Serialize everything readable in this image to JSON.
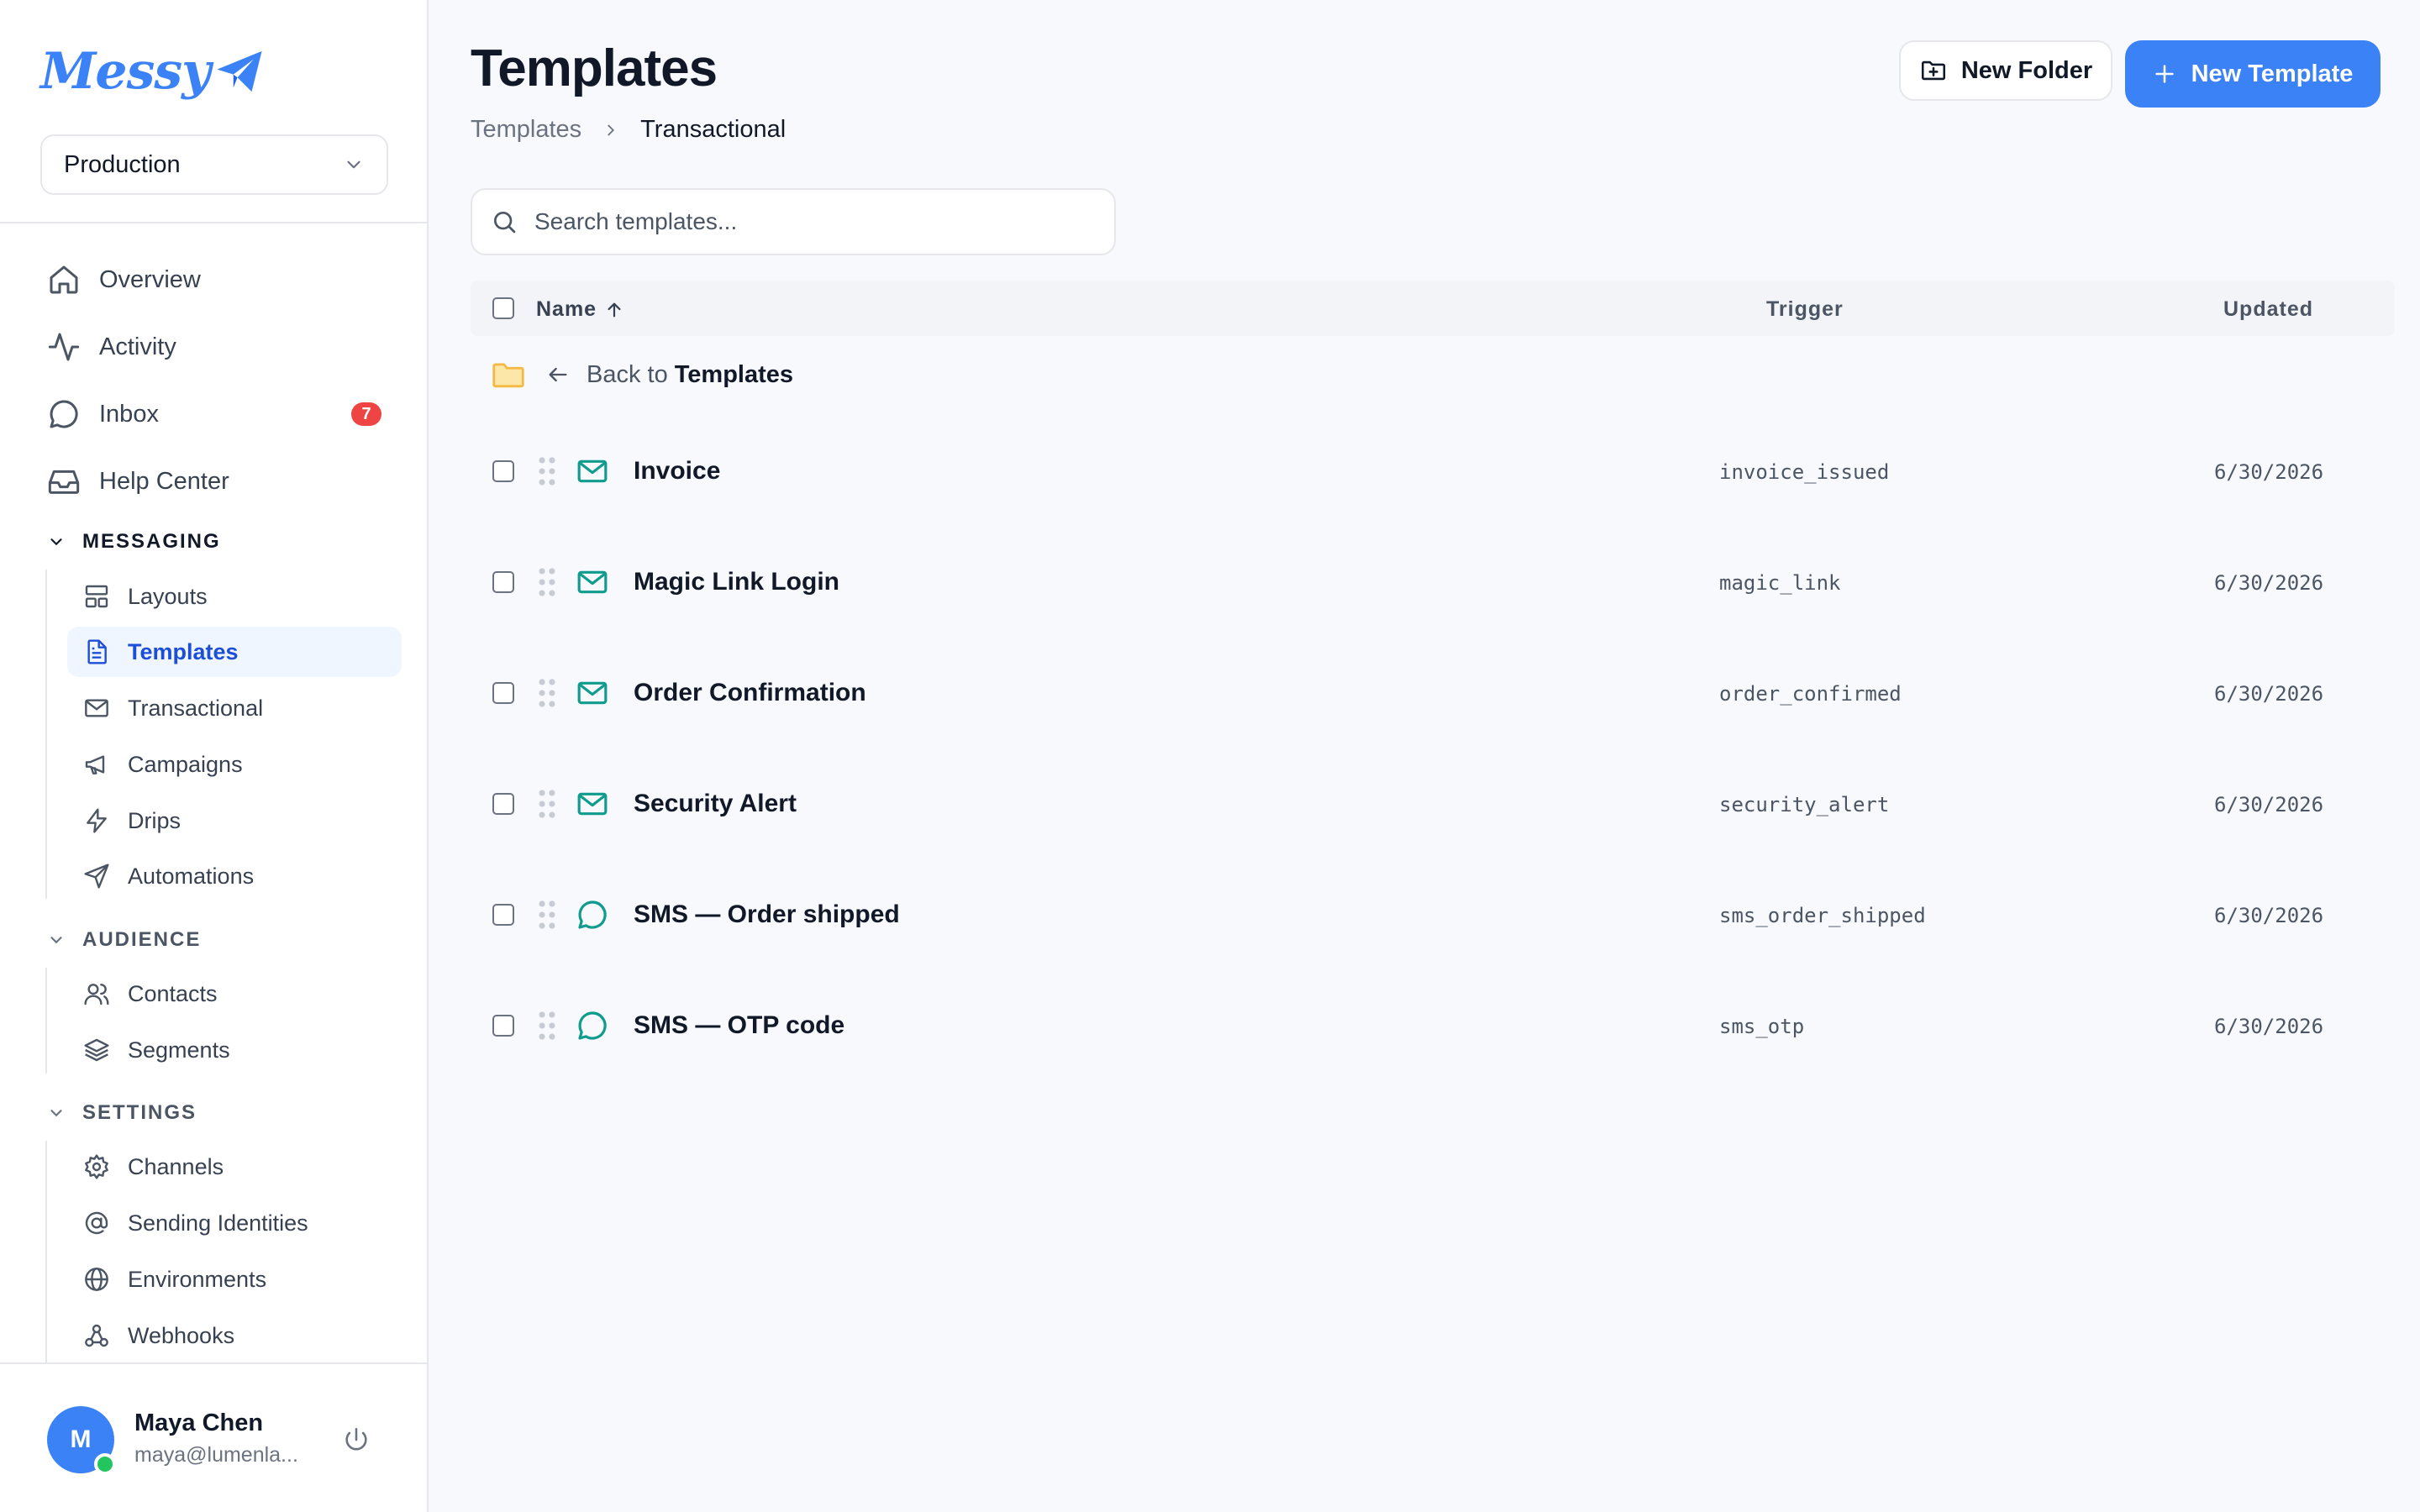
{
  "sidebar": {
    "logo_text": "Messy",
    "environment": "Production",
    "nav": [
      {
        "label": "Overview",
        "icon": "home-icon"
      },
      {
        "label": "Activity",
        "icon": "activity-icon"
      },
      {
        "label": "Inbox",
        "icon": "chat-bubble-icon",
        "badge": "7"
      },
      {
        "label": "Help Center",
        "icon": "inbox-tray-icon"
      }
    ],
    "sections": {
      "messaging": {
        "title": "MESSAGING",
        "items": [
          {
            "label": "Layouts",
            "icon": "layout-icon"
          },
          {
            "label": "Templates",
            "icon": "document-icon",
            "active": true
          },
          {
            "label": "Transactional",
            "icon": "mail-icon"
          },
          {
            "label": "Campaigns",
            "icon": "megaphone-icon"
          },
          {
            "label": "Drips",
            "icon": "lightning-icon"
          },
          {
            "label": "Automations",
            "icon": "send-icon"
          }
        ]
      },
      "audience": {
        "title": "AUDIENCE",
        "items": [
          {
            "label": "Contacts",
            "icon": "users-icon"
          },
          {
            "label": "Segments",
            "icon": "layers-icon"
          }
        ]
      },
      "settings": {
        "title": "SETTINGS",
        "items": [
          {
            "label": "Channels",
            "icon": "gear-icon"
          },
          {
            "label": "Sending Identities",
            "icon": "at-sign-icon"
          },
          {
            "label": "Environments",
            "icon": "globe-icon"
          },
          {
            "label": "Webhooks",
            "icon": "webhook-icon"
          }
        ]
      }
    },
    "user": {
      "initial": "M",
      "name": "Maya Chen",
      "email": "maya@lumenla..."
    }
  },
  "header": {
    "title": "Templates",
    "breadcrumb": {
      "root": "Templates",
      "current": "Transactional"
    },
    "new_folder_label": "New Folder",
    "new_template_label": "New Template"
  },
  "search": {
    "placeholder": "Search templates...",
    "value": ""
  },
  "table": {
    "columns": {
      "name": "Name",
      "trigger": "Trigger",
      "updated": "Updated"
    },
    "back_row": {
      "prefix": "Back to",
      "target": "Templates"
    },
    "rows": [
      {
        "name": "Invoice",
        "type": "email",
        "trigger": "invoice_issued",
        "updated": "6/30/2026"
      },
      {
        "name": "Magic Link Login",
        "type": "email",
        "trigger": "magic_link",
        "updated": "6/30/2026"
      },
      {
        "name": "Order Confirmation",
        "type": "email",
        "trigger": "order_confirmed",
        "updated": "6/30/2026"
      },
      {
        "name": "Security Alert",
        "type": "email",
        "trigger": "security_alert",
        "updated": "6/30/2026"
      },
      {
        "name": "SMS — Order shipped",
        "type": "sms",
        "trigger": "sms_order_shipped",
        "updated": "6/30/2026"
      },
      {
        "name": "SMS — OTP code",
        "type": "sms",
        "trigger": "sms_otp",
        "updated": "6/30/2026"
      }
    ]
  },
  "colors": {
    "accent": "#3b82f6",
    "active_bg": "#eff6ff",
    "channel_icon": "#0f9b8e",
    "folder_icon": "#f5b942",
    "badge": "#ef4444",
    "online": "#22c55e"
  }
}
